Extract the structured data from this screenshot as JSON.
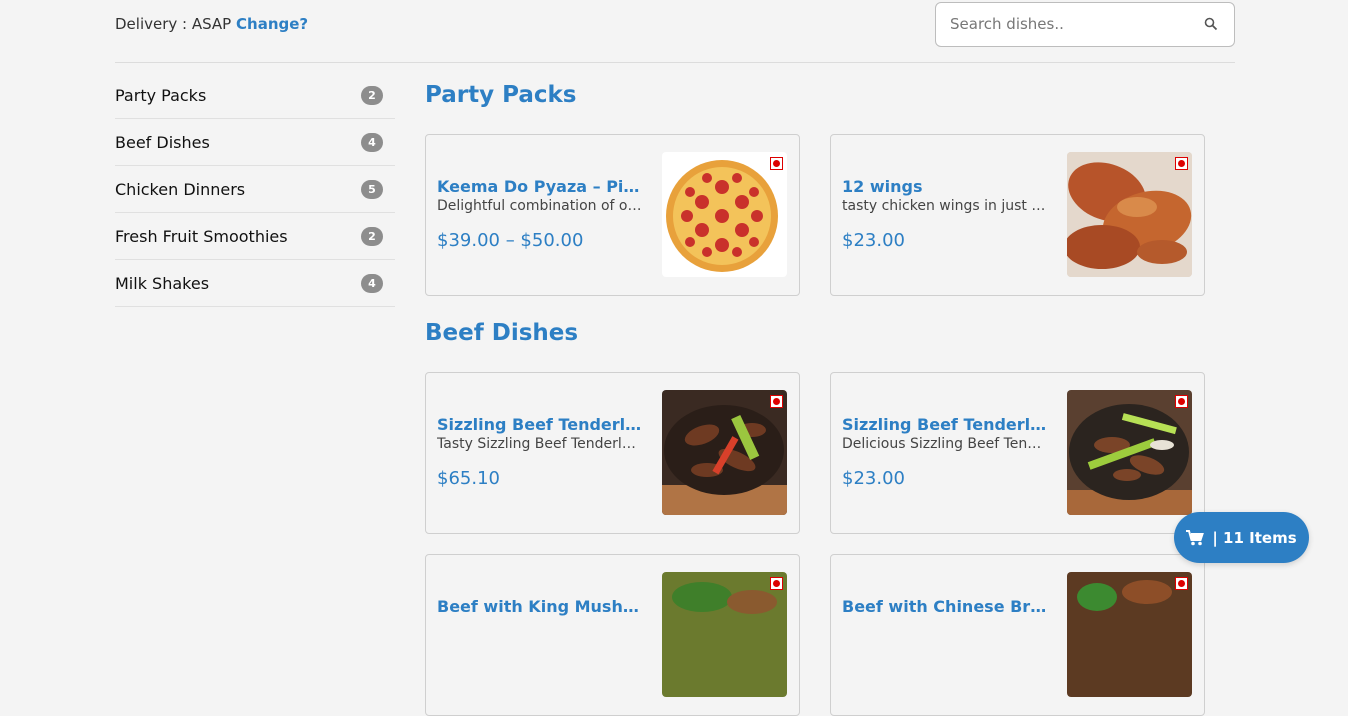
{
  "header": {
    "delivery_label": "Delivery : ASAP",
    "change_link": "Change?",
    "search_placeholder": "Search dishes.."
  },
  "sidebar": {
    "items": [
      {
        "label": "Party Packs",
        "count": "2"
      },
      {
        "label": "Beef Dishes",
        "count": "4"
      },
      {
        "label": "Chicken Dinners",
        "count": "5"
      },
      {
        "label": "Fresh Fruit Smoothies",
        "count": "2"
      },
      {
        "label": "Milk Shakes",
        "count": "4"
      }
    ]
  },
  "sections": [
    {
      "title": "Party Packs",
      "items": [
        {
          "name": "Keema Do Pyaza – Pizza",
          "desc": "Delightful combination of onion and spicy keema",
          "price": "$39.00 – $50.00",
          "image": "pizza"
        },
        {
          "name": "12 wings",
          "desc": "tasty chicken wings in just right spice",
          "price": "$23.00",
          "image": "wings"
        }
      ]
    },
    {
      "title": "Beef Dishes",
      "items": [
        {
          "name": "Sizzling Beef Tenderloin Special",
          "desc": "Tasty Sizzling Beef Tenderloin",
          "price": "$65.10",
          "image": "beef"
        },
        {
          "name": "Sizzling Beef Tenderloin",
          "desc": "Delicious Sizzling Beef  Tenderloin",
          "price": "$23.00",
          "image": "beef2"
        },
        {
          "name": "Beef with King Mushroom",
          "desc": "",
          "price": "",
          "image": "mushroom"
        },
        {
          "name": "Beef with Chinese Brocc",
          "desc": "",
          "price": "",
          "image": "broccoli"
        }
      ]
    }
  ],
  "cart": {
    "label": "| 11 Items"
  },
  "colors": {
    "accent": "#2d7fc4",
    "badge": "#8d8d8d",
    "veg_marker": "#dd0000"
  }
}
